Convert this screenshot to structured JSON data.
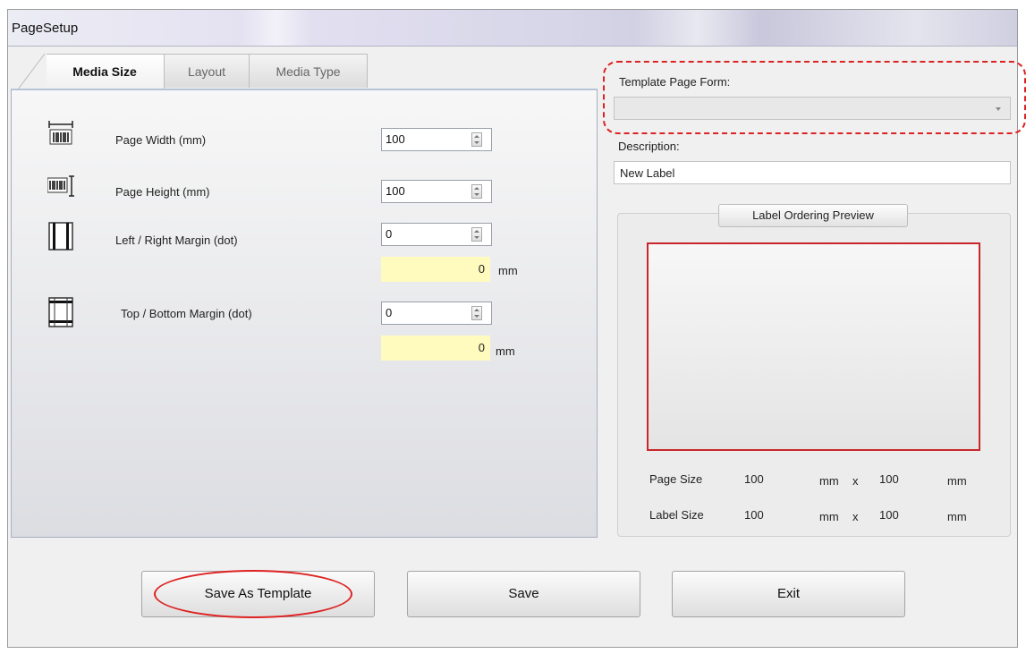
{
  "window": {
    "title": "PageSetup"
  },
  "tabs": [
    {
      "label": "Media Size",
      "active": true
    },
    {
      "label": "Layout",
      "active": false
    },
    {
      "label": "Media Type",
      "active": false
    }
  ],
  "media_size": {
    "page_width": {
      "label": "Page Width (mm)",
      "value": "100",
      "icon": "page-width-icon"
    },
    "page_height": {
      "label": "Page Height (mm)",
      "value": "100",
      "icon": "page-height-icon"
    },
    "lr_margin": {
      "label": "Left / Right Margin (dot)",
      "value": "0",
      "mm": "0",
      "unit": "mm",
      "icon": "left-right-margin-icon"
    },
    "tb_margin": {
      "label": "Top / Bottom Margin (dot)",
      "value": "0",
      "mm": "0",
      "unit": "mm",
      "icon": "top-bottom-margin-icon"
    }
  },
  "template": {
    "label": "Template Page Form:",
    "value": ""
  },
  "description": {
    "label": "Description:",
    "value": "New Label"
  },
  "preview": {
    "title": "Label Ordering Preview",
    "page_size": {
      "label": "Page Size",
      "width": "100",
      "unit1": "mm",
      "x": "x",
      "height": "100",
      "unit2": "mm"
    },
    "label_size": {
      "label": "Label Size",
      "width": "100",
      "unit1": "mm",
      "x": "x",
      "height": "100",
      "unit2": "mm"
    }
  },
  "buttons": {
    "save_template": "Save As Template",
    "save": "Save",
    "exit": "Exit"
  },
  "colors": {
    "highlight": "#d22222",
    "mm_field": "#fffbbe",
    "preview_border": "#c8262a"
  }
}
